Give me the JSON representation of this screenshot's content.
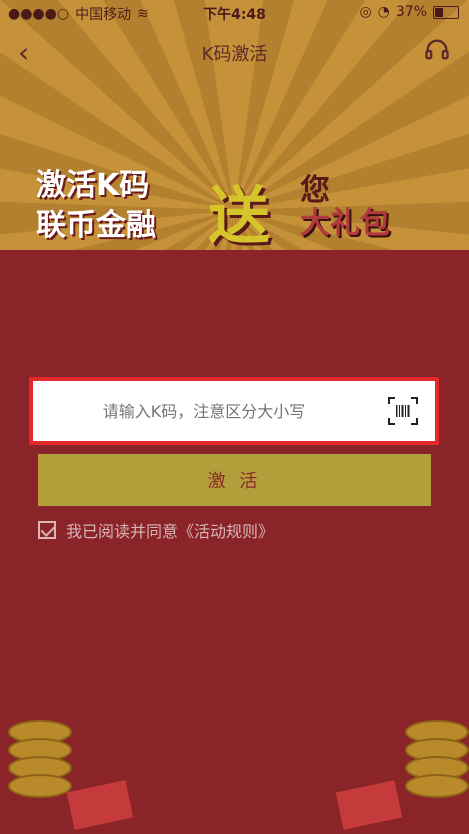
{
  "status_bar": {
    "carrier": "中国移动",
    "time": "下午4:48",
    "battery": "37%"
  },
  "nav": {
    "title": "K码激活",
    "back_icon": "chevron-left-icon",
    "service_icon": "headset-icon"
  },
  "banner": {
    "line1": "激活K码",
    "line2": "联币金融",
    "big": "送",
    "line3": "您",
    "line4": "大礼包"
  },
  "form": {
    "placeholder": "请输入K码，注意区分大小写",
    "scan_icon": "barcode-scan-icon",
    "activate_label": "激 活"
  },
  "agreement": {
    "text": "我已阅读并同意《活动规则》",
    "checked": true
  },
  "colors": {
    "page_bg": "#8b2428",
    "button_bg": "#b39f3a",
    "highlight_border": "#e3282c"
  }
}
